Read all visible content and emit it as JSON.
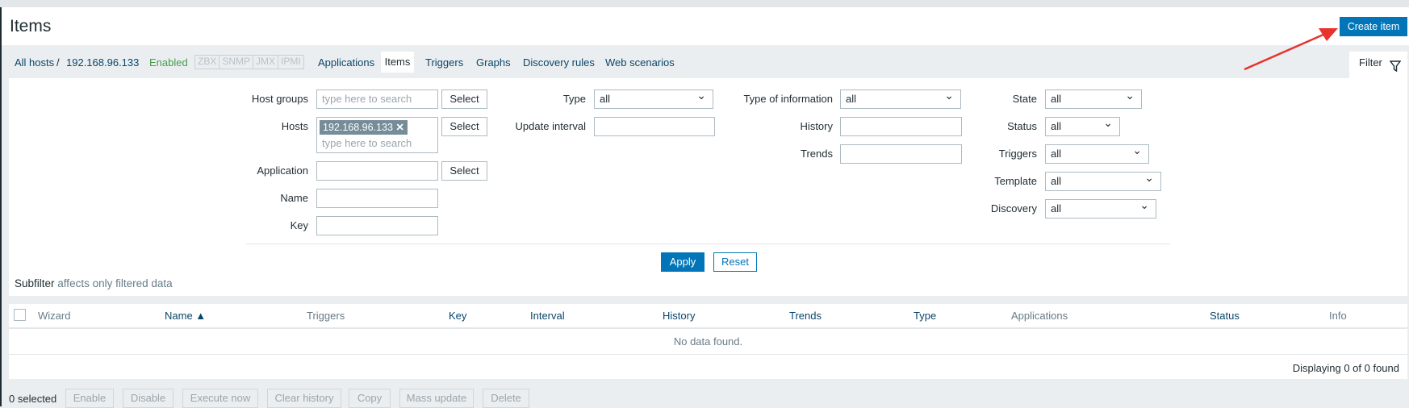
{
  "header": {
    "title": "Items",
    "create_button": "Create item"
  },
  "nav": {
    "all_hosts": "All hosts",
    "separator": "/",
    "host": "192.168.96.133",
    "status": "Enabled",
    "interfaces": [
      "ZBX",
      "SNMP",
      "JMX",
      "IPMI"
    ],
    "tabs": [
      "Applications",
      "Items",
      "Triggers",
      "Graphs",
      "Discovery rules",
      "Web scenarios"
    ],
    "active_tab": "Items",
    "filter_tab": "Filter"
  },
  "filter": {
    "host_groups": {
      "label": "Host groups",
      "placeholder": "type here to search",
      "select": "Select"
    },
    "hosts": {
      "label": "Hosts",
      "chip": "192.168.96.133",
      "placeholder": "type here to search",
      "select": "Select"
    },
    "application": {
      "label": "Application",
      "value": "",
      "select": "Select"
    },
    "name": {
      "label": "Name",
      "value": ""
    },
    "key": {
      "label": "Key",
      "value": ""
    },
    "type": {
      "label": "Type",
      "value": "all"
    },
    "update_interval": {
      "label": "Update interval",
      "value": ""
    },
    "type_of_information": {
      "label": "Type of information",
      "value": "all"
    },
    "history": {
      "label": "History",
      "value": ""
    },
    "trends": {
      "label": "Trends",
      "value": ""
    },
    "state": {
      "label": "State",
      "value": "all"
    },
    "status": {
      "label": "Status",
      "value": "all"
    },
    "triggers": {
      "label": "Triggers",
      "value": "all"
    },
    "template": {
      "label": "Template",
      "value": "all"
    },
    "discovery": {
      "label": "Discovery",
      "value": "all"
    },
    "apply": "Apply",
    "reset": "Reset",
    "subfilter": "Subfilter",
    "subfilter_note": "affects only filtered data"
  },
  "table": {
    "columns": [
      "Wizard",
      "Name ▲",
      "Triggers",
      "Key",
      "Interval",
      "History",
      "Trends",
      "Type",
      "Applications",
      "Status",
      "Info"
    ],
    "empty": "No data found.",
    "footer": "Displaying 0 of 0 found"
  },
  "actions": {
    "selected": "0 selected",
    "buttons": [
      "Enable",
      "Disable",
      "Execute now",
      "Clear history",
      "Copy",
      "Mass update",
      "Delete"
    ]
  },
  "colors": {
    "accent": "#0275b8",
    "enabled": "#429e47",
    "annotation_arrow": "#e8322d"
  }
}
